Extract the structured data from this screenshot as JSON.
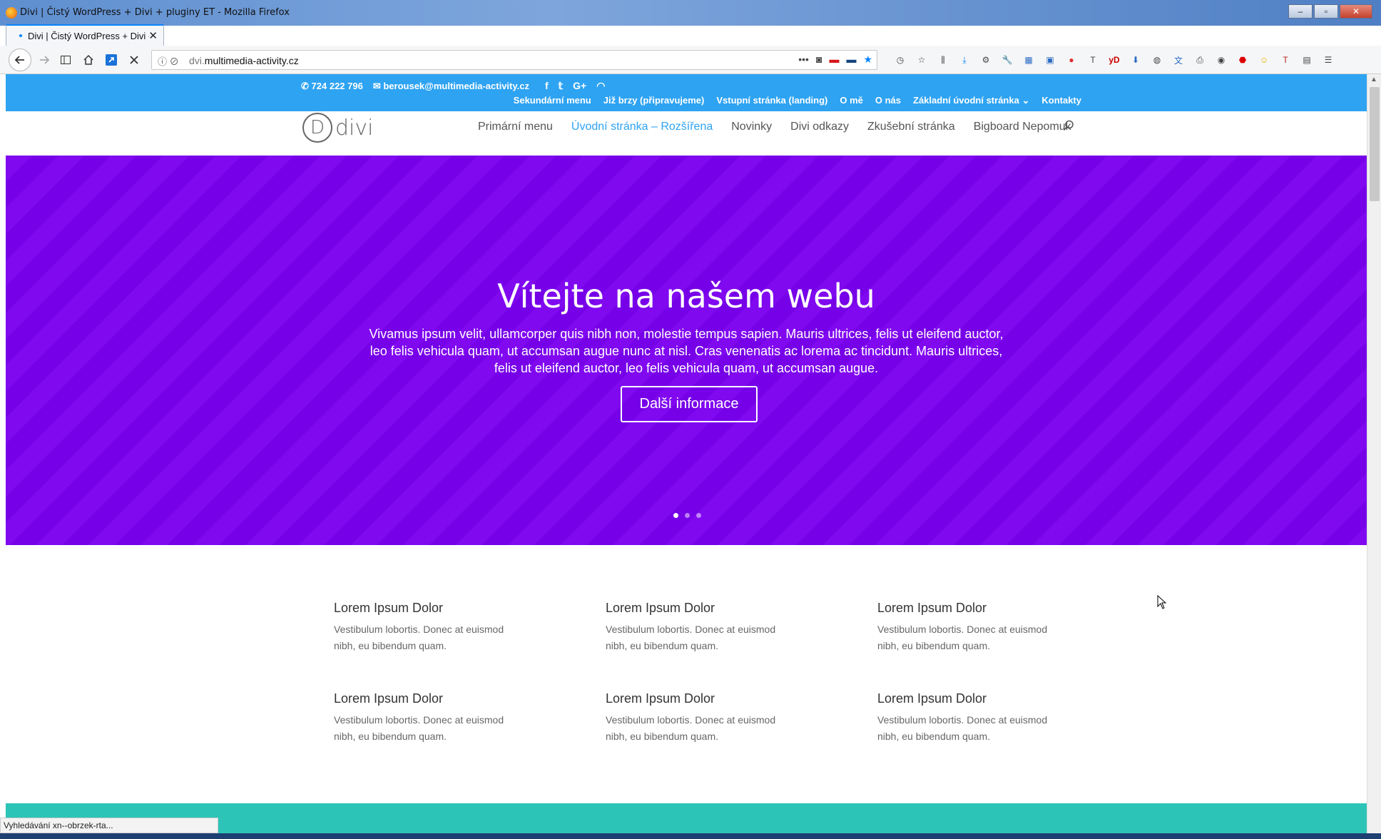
{
  "window": {
    "title": "Divi | Čistý WordPress + Divi + pluginy ET - Mozilla Firefox",
    "minimize": "–",
    "maximize": "▫",
    "close": "✕"
  },
  "tab": {
    "label": "Divi | Čistý WordPress + Divi + pluginy ET",
    "close": "✕",
    "new": "+"
  },
  "toolbar": {
    "url_prefix": "dvi.",
    "url_domain": "multimedia-activity.cz",
    "more": "•••"
  },
  "topbar": {
    "phone": "724 222 796",
    "email": "berousek@multimedia-activity.cz",
    "secondary_menu": [
      "Sekundární menu",
      "Již brzy (připravujeme)",
      "Vstupní stránka (landing)",
      "O mě",
      "O nás",
      "Základní úvodní stránka",
      "Kontakty"
    ]
  },
  "header": {
    "logo_letter": "D",
    "logo_word": "divi",
    "primary_menu": [
      "Primární menu",
      "Úvodní stránka – Rozšířena",
      "Novinky",
      "Divi odkazy",
      "Zkušební stránka",
      "Bigboard Nepomuk"
    ]
  },
  "hero": {
    "title": "Vítejte na našem webu",
    "text": "Vivamus ipsum velit, ullamcorper quis nibh non, molestie tempus sapien. Mauris ultrices, felis ut eleifend auctor, leo felis vehicula quam, ut accumsan augue nunc at nisl. Cras venenatis ac lorema ac tincidunt. Mauris ultrices, felis ut eleifend auctor, leo felis vehicula quam, ut accumsan augue.",
    "button": "Další informace",
    "slides": 3,
    "active_slide": 1
  },
  "blurbs": [
    {
      "title": "Lorem Ipsum Dolor",
      "text": "Vestibulum lobortis. Donec at euismod nibh, eu bibendum quam."
    },
    {
      "title": "Lorem Ipsum Dolor",
      "text": "Vestibulum lobortis. Donec at euismod nibh, eu bibendum quam."
    },
    {
      "title": "Lorem Ipsum Dolor",
      "text": "Vestibulum lobortis. Donec at euismod nibh, eu bibendum quam."
    },
    {
      "title": "Lorem Ipsum Dolor",
      "text": "Vestibulum lobortis. Donec at euismod nibh, eu bibendum quam."
    },
    {
      "title": "Lorem Ipsum Dolor",
      "text": "Vestibulum lobortis. Donec at euismod nibh, eu bibendum quam."
    },
    {
      "title": "Lorem Ipsum Dolor",
      "text": "Vestibulum lobortis. Donec at euismod nibh, eu bibendum quam."
    }
  ],
  "status": "Vyhledávání xn--obrzek-rta...",
  "colors": {
    "topbar": "#2ea3f2",
    "hero": "#7b00f0",
    "accent": "#2ea3f2",
    "footer_band": "#2cc4b7"
  }
}
